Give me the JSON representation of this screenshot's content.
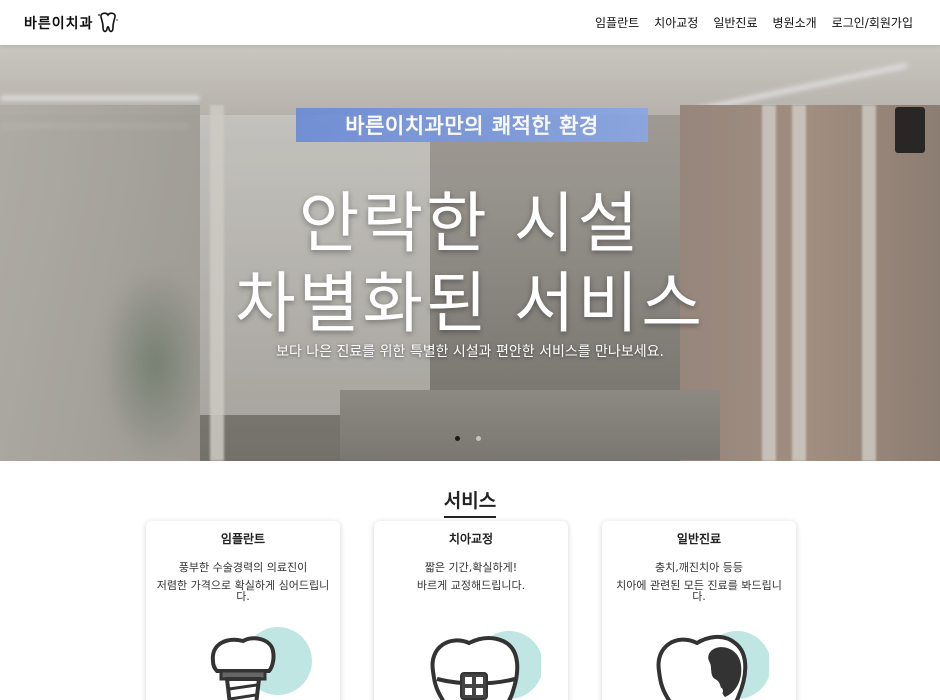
{
  "header": {
    "logo_text": "바른이치과",
    "logo_icon": "tooth-icon",
    "nav": [
      {
        "label": "임플란트"
      },
      {
        "label": "치아교정"
      },
      {
        "label": "일반진료"
      },
      {
        "label": "병원소개"
      },
      {
        "label": "로그인/회원가입"
      }
    ]
  },
  "hero": {
    "badge": "바른이치과만의 쾌적한 환경",
    "title_line1": "안락한 시설",
    "title_line2": "차별화된 서비스",
    "subtitle": "보다 나은 진료를 위한 특별한 시설과 편안한 서비스를 만나보세요.",
    "slides": 2,
    "active_slide": 1
  },
  "services": {
    "heading": "서비스",
    "cards": [
      {
        "title": "임플란트",
        "line1": "풍부한 수술경력의 의료진이",
        "line2": "저렴한 가격으로 확실하게 심어드립니다.",
        "icon": "implant-tooth-icon"
      },
      {
        "title": "치아교정",
        "line1": "짧은 기간,확실하게!",
        "line2": "바르게 교정해드립니다.",
        "icon": "braces-tooth-icon"
      },
      {
        "title": "일반진료",
        "line1": "충치,깨진치아 등등",
        "line2": "치아에 관련된 모든 진료를 봐드립니다.",
        "icon": "cavity-tooth-icon"
      }
    ]
  },
  "colors": {
    "badge": "#7a98dd",
    "accent_teal": "#bfe6e3",
    "icon_stroke": "#333333"
  }
}
